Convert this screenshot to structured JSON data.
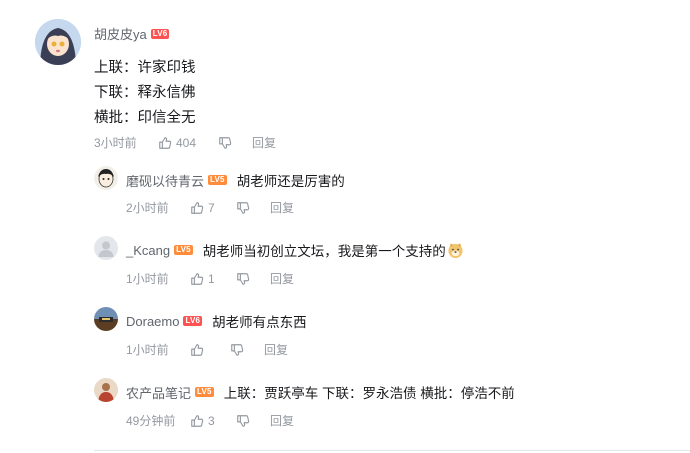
{
  "main_comment": {
    "username": "胡皮皮ya",
    "level": "LV6",
    "lines": [
      "上联：许家印钱",
      "下联：释永信佛",
      "横批：印信全无"
    ],
    "time": "3小时前",
    "likes": "404",
    "reply_label": "回复"
  },
  "replies": [
    {
      "username": "磨砚以待青云",
      "level": "LV5",
      "text": "胡老师还是厉害的",
      "time": "2小时前",
      "likes": "7",
      "reply_label": "回复"
    },
    {
      "username": "_Kcang",
      "level": "LV5",
      "text": "胡老师当初创立文坛，我是第一个支持的",
      "time": "1小时前",
      "likes": "1",
      "reply_label": "回复"
    },
    {
      "username": "Doraemo",
      "level": "LV6",
      "text": "胡老师有点东西",
      "time": "1小时前",
      "likes": "",
      "reply_label": "回复"
    },
    {
      "username": "农产品笔记",
      "level": "LV5",
      "text": "上联：贾跃亭车 下联：罗永浩债 横批：停浩不前",
      "time": "49分钟前",
      "likes": "3",
      "reply_label": "回复"
    }
  ],
  "colors": {
    "level6": "#ff5252",
    "level5": "#ff8c3a",
    "muted": "#9499a0",
    "name": "#61666d"
  }
}
